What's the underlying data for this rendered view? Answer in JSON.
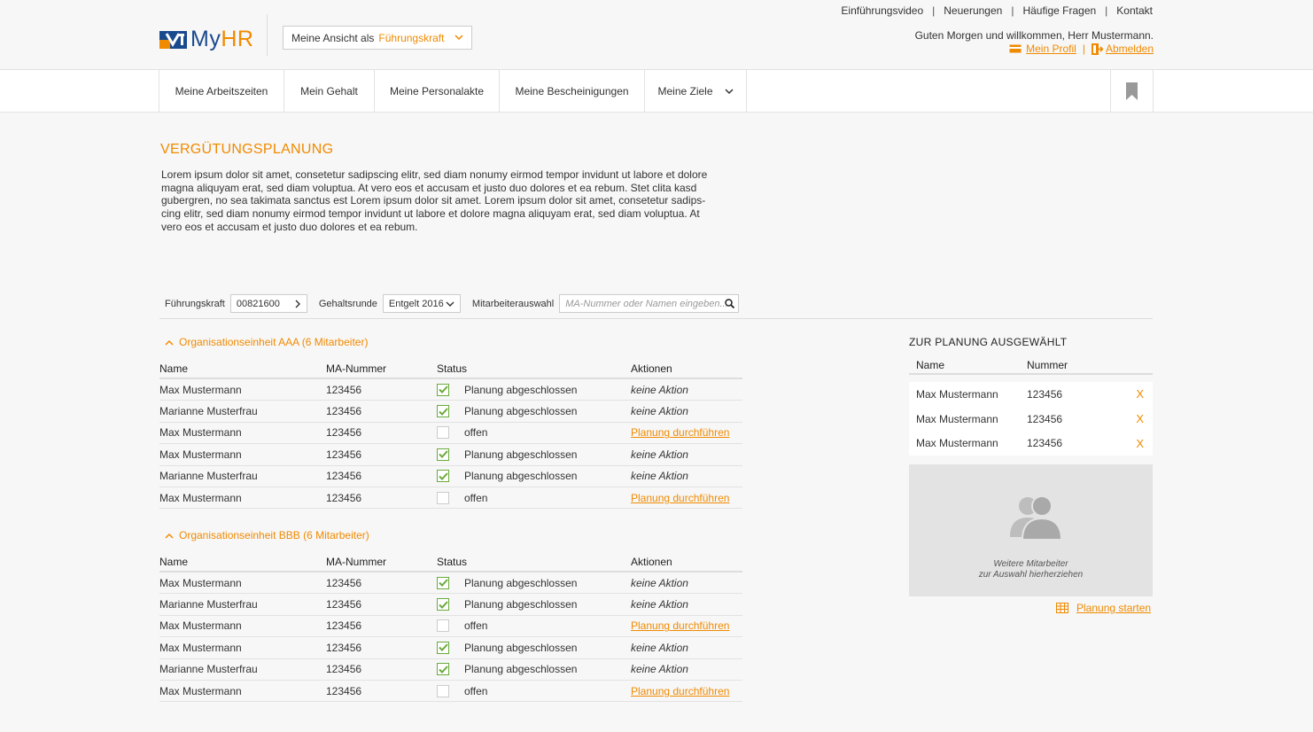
{
  "header": {
    "logo_text": "My",
    "logo_text_accent": "HR",
    "view_select": {
      "label": "Meine Ansicht als",
      "value": "Führungskraft"
    },
    "top_links": [
      "Einführungsvideo",
      "Neuerungen",
      "Häufige Fragen",
      "Kontakt"
    ],
    "greeting": "Guten Morgen und willkommen, Herr Mustermann.",
    "profile_link": "Mein Profil",
    "logout_link": "Abmelden"
  },
  "nav": {
    "items": [
      "Meine Arbeitszeiten",
      "Mein Gehalt",
      "Meine Personalakte",
      "Meine Bescheinigungen",
      "Meine Ziele"
    ]
  },
  "main": {
    "title": "VERGÜTUNGSPLANUNG",
    "intro_lines": [
      "Lorem ipsum dolor sit amet, consetetur sadipscing elitr, sed diam nonumy eirmod tempor invidunt ut labore et dolore",
      "magna aliquyam erat, sed diam voluptua. At vero eos et accusam et justo duo dolores et ea rebum. Stet clita kasd",
      "gubergren, no sea takimata sanctus est Lorem ipsum dolor sit amet. Lorem ipsum dolor sit amet, consetetur sadips-",
      "cing elitr, sed diam nonumy eirmod tempor invidunt ut labore et dolore magna aliquyam erat, sed diam voluptua. At",
      "vero eos et accusam et justo duo dolores et ea rebum."
    ]
  },
  "filters": {
    "manager_label": "Führungskraft",
    "manager_value": "00821600",
    "round_label": "Gehaltsrunde",
    "round_value": "Entgelt 2016",
    "employee_label": "Mitarbeiterauswahl",
    "employee_placeholder": "MA-Nummer oder Namen eingeben..."
  },
  "table_headers": {
    "name": "Name",
    "number": "MA-Nummer",
    "status": "Status",
    "actions": "Aktionen"
  },
  "groups": [
    {
      "title": "Organisationseinheit AAA (6 Mitarbeiter)",
      "rows": [
        {
          "name": "Max Mustermann",
          "number": "123456",
          "done": true,
          "status": "Planung abgeschlossen",
          "action": "keine Aktion"
        },
        {
          "name": "Marianne Musterfrau",
          "number": "123456",
          "done": true,
          "status": "Planung abgeschlossen",
          "action": "keine Aktion"
        },
        {
          "name": "Max Mustermann",
          "number": "123456",
          "done": false,
          "status": "offen",
          "action": "Planung durchführen"
        },
        {
          "name": "Max Mustermann",
          "number": "123456",
          "done": true,
          "status": "Planung abgeschlossen",
          "action": "keine Aktion"
        },
        {
          "name": "Marianne Musterfrau",
          "number": "123456",
          "done": true,
          "status": "Planung abgeschlossen",
          "action": "keine Aktion"
        },
        {
          "name": "Max Mustermann",
          "number": "123456",
          "done": false,
          "status": "offen",
          "action": "Planung durchführen"
        }
      ]
    },
    {
      "title": "Organisationseinheit BBB (6 Mitarbeiter)",
      "rows": [
        {
          "name": "Max Mustermann",
          "number": "123456",
          "done": true,
          "status": "Planung abgeschlossen",
          "action": "keine Aktion"
        },
        {
          "name": "Marianne Musterfrau",
          "number": "123456",
          "done": true,
          "status": "Planung abgeschlossen",
          "action": "keine Aktion"
        },
        {
          "name": "Max Mustermann",
          "number": "123456",
          "done": false,
          "status": "offen",
          "action": "Planung durchführen"
        },
        {
          "name": "Max Mustermann",
          "number": "123456",
          "done": true,
          "status": "Planung abgeschlossen",
          "action": "keine Aktion"
        },
        {
          "name": "Marianne Musterfrau",
          "number": "123456",
          "done": true,
          "status": "Planung abgeschlossen",
          "action": "keine Aktion"
        },
        {
          "name": "Max Mustermann",
          "number": "123456",
          "done": false,
          "status": "offen",
          "action": "Planung durchführen"
        }
      ]
    }
  ],
  "selection": {
    "title": "ZUR PLANUNG AUSGEWÄHLT",
    "head_name": "Name",
    "head_number": "Nummer",
    "rows": [
      {
        "name": "Max Mustermann",
        "number": "123456",
        "remove": "X"
      },
      {
        "name": "Max Mustermann",
        "number": "123456",
        "remove": "X"
      },
      {
        "name": "Max Mustermann",
        "number": "123456",
        "remove": "X"
      }
    ],
    "dropzone_line1": "Weitere Mitarbeiter",
    "dropzone_line2": "zur Auswahl hierherziehen",
    "start_label": "Planung starten"
  },
  "colors": {
    "accent": "#f08a00",
    "brand_blue": "#1a4a8e",
    "check_green": "#6aab3c"
  },
  "icons": [
    "logo-mark-icon",
    "chevron-down-icon",
    "card-icon",
    "logout-icon",
    "bookmark-icon",
    "chevron-right-icon",
    "search-icon",
    "chevron-up-icon",
    "check-icon",
    "users-icon",
    "table-icon"
  ]
}
